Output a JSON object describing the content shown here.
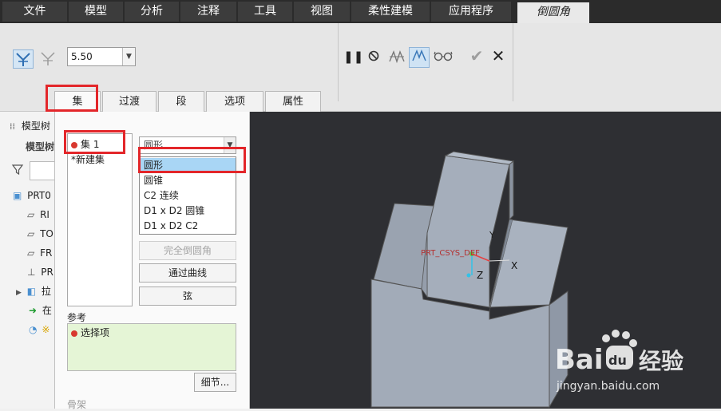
{
  "menu": {
    "items": [
      "文件",
      "模型",
      "分析",
      "注释",
      "工具",
      "视图",
      "柔性建模",
      "应用程序"
    ],
    "active_tab": "倒圆角"
  },
  "ribbon": {
    "radius_value": "5.50",
    "tabs": [
      "集",
      "过渡",
      "段",
      "选项",
      "属性"
    ]
  },
  "tree": {
    "title": "模型树",
    "subtitle": "模型树",
    "rows": [
      "PRT0",
      "RI",
      "TO",
      "FR",
      "PR",
      "拉",
      "在",
      "※"
    ]
  },
  "set_panel": {
    "sets": [
      "集 1",
      "*新建集"
    ],
    "shape_selected": "圆形",
    "shape_options": [
      "圆形",
      "圆锥",
      "C2 连续",
      "D1 x D2 圆锥",
      "D1 x D2 C2"
    ],
    "buttons": {
      "full_round": "完全倒圆角",
      "through_curve": "通过曲线",
      "chord": "弦"
    },
    "reference_label": "参考",
    "reference_item": "选择项",
    "detail_button": "细节...",
    "skeleton_label": "骨架"
  },
  "viewport": {
    "csys_label": "PRT_CSYS_DEF",
    "axis_x": "X",
    "axis_y": "Y",
    "axis_z": "Z",
    "watermark_main": "Bai",
    "watermark_du": "du",
    "watermark_cn": "经验",
    "watermark_url": "jingyan.baidu.com"
  },
  "colors": {
    "menubar": "#2b2b2b",
    "viewport_bg": "#2e2f33",
    "part_face": "#a6afbc",
    "annotation_red": "#e3262a",
    "selection_blue": "#a9d6f5"
  }
}
